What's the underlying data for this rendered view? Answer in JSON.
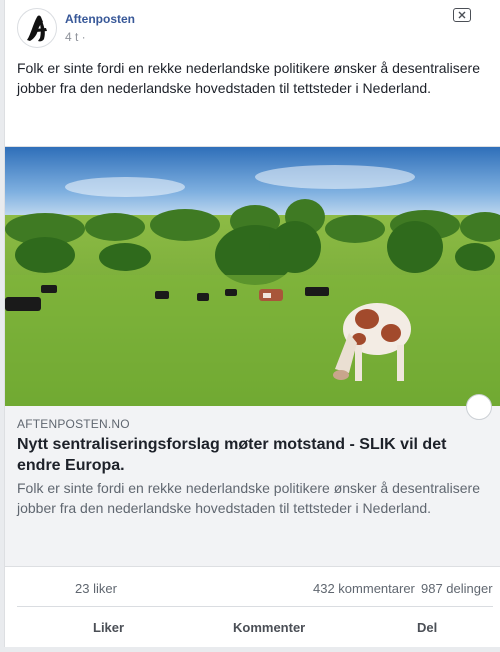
{
  "post": {
    "page_name": "Aftenposten",
    "timestamp": "4 t ·",
    "text": "Folk er sinte fordi en rekke nederlandske politikere ønsker å desentralisere jobber fra den nederlandske hovedstaden til tettsteder i Nederland."
  },
  "link": {
    "domain": "AFTENPOSTEN.NO",
    "title": "Nytt sentraliseringsforslag møter motstand - SLIK vil det endre Europa.",
    "description": "Folk er sinte fordi en rekke nederlandske politikere ønsker å desentralisere jobber fra den nederlandske hovedstaden til tettsteder i Nederland."
  },
  "stats": {
    "likes": "23 liker",
    "comments": "432 kommentarer",
    "shares": "987 delinger"
  },
  "actions": {
    "like": "Liker",
    "comment": "Kommenter",
    "share": "Del"
  },
  "icons": {
    "avatar": "aftenposten-logo",
    "close": "close-icon"
  },
  "colors": {
    "page_name": "#385898",
    "link_bg": "#f2f3f5"
  }
}
